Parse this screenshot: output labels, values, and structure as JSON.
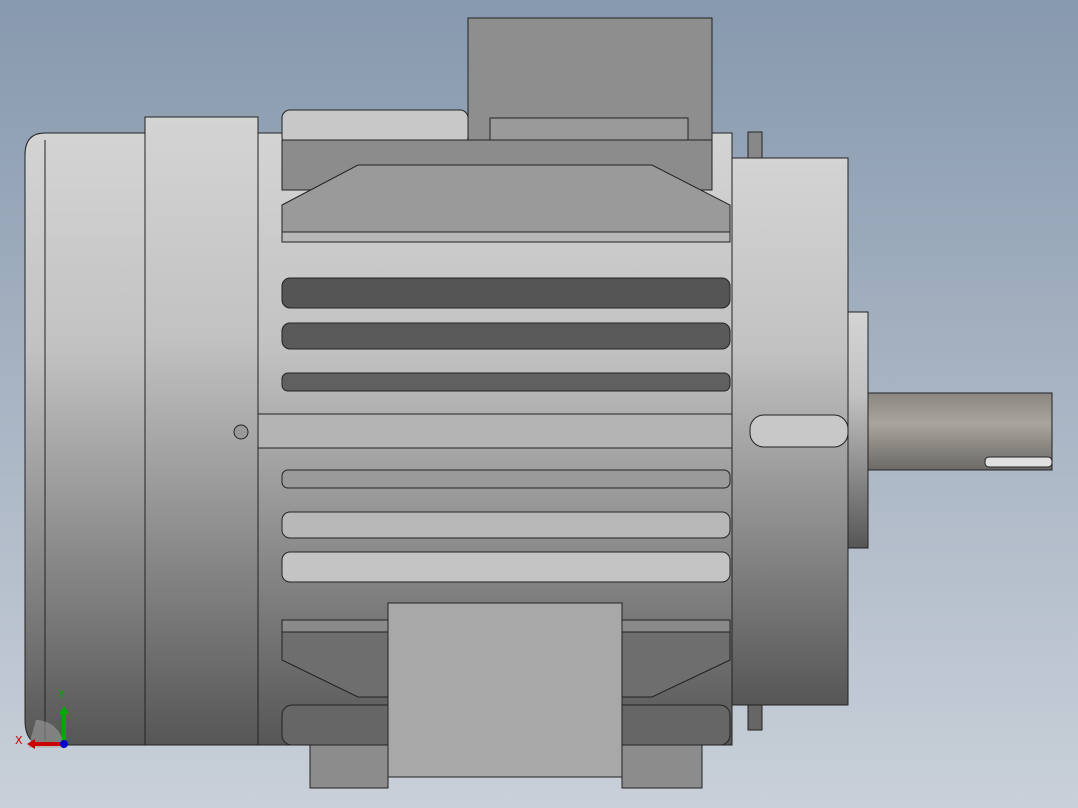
{
  "viewport": {
    "triad": {
      "x_label": "X",
      "y_label": "Y",
      "x_color": "#cc0000",
      "y_color": "#00aa00",
      "z_color": "#0000cc"
    },
    "colors": {
      "bg_top": "#8799ae",
      "bg_bottom": "#c9d0d9"
    }
  }
}
